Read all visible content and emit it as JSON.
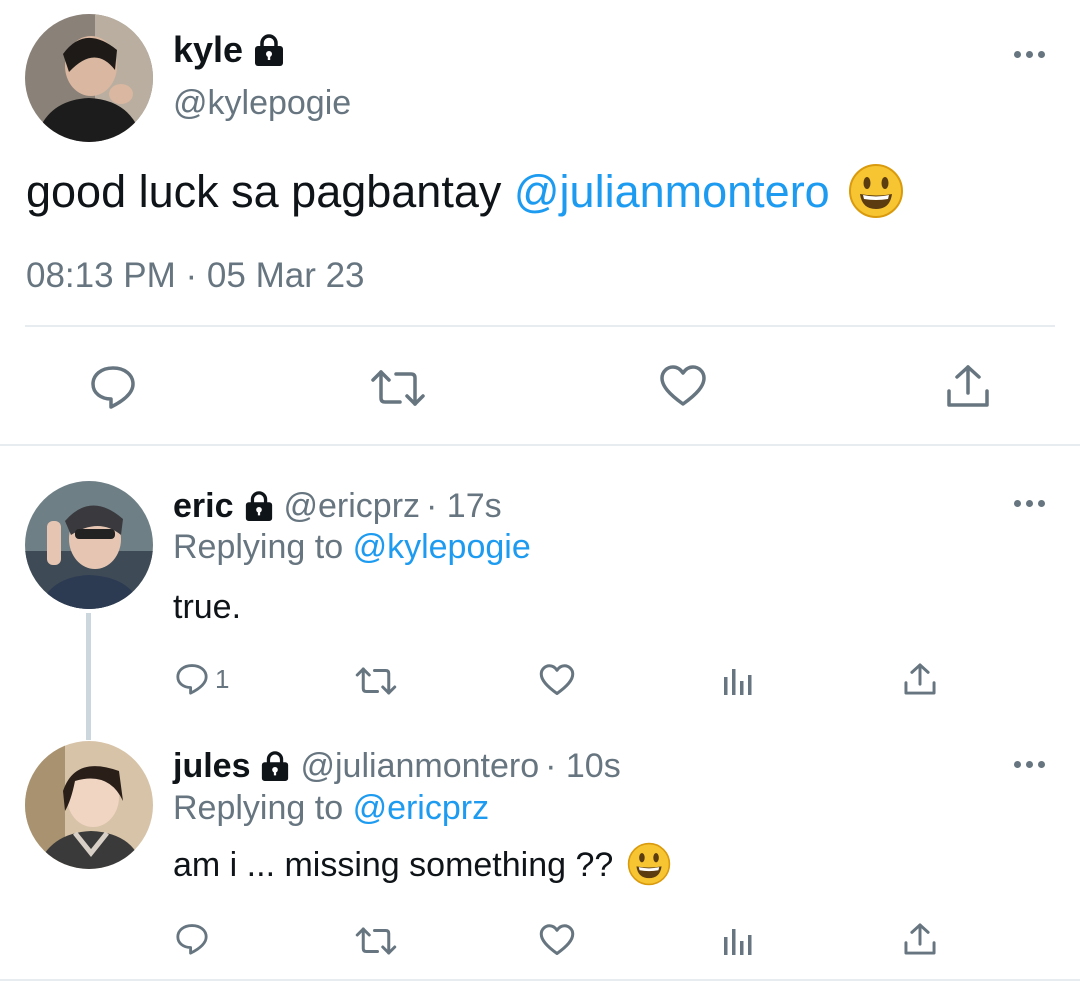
{
  "main_tweet": {
    "display_name": "kyle",
    "handle": "@kylepogie",
    "text": "good luck sa pagbantay",
    "mention": "@julianmontero",
    "emoji": "smiley-emoji",
    "timestamp": "08:13 PM · 05 Mar 23",
    "actions": [
      "reply-icon",
      "retweet-icon",
      "like-icon",
      "share-icon"
    ]
  },
  "replies": [
    {
      "display_name": "eric",
      "handle": "@ericprz",
      "time": "· 17s",
      "replying_label": "Replying to",
      "replying_to": "@kylepogie",
      "text": "true.",
      "reply_count": "1"
    },
    {
      "display_name": "jules",
      "handle": "@julianmontero",
      "time": "· 10s",
      "replying_label": "Replying to",
      "replying_to": "@ericprz",
      "text": "am i ... missing something ??",
      "emoji": "smiley-emoji"
    }
  ],
  "colors": {
    "accent": "#1d9bf0",
    "muted_text": "#66757f",
    "divider": "#e6ecf0",
    "text": "#0f1419"
  }
}
